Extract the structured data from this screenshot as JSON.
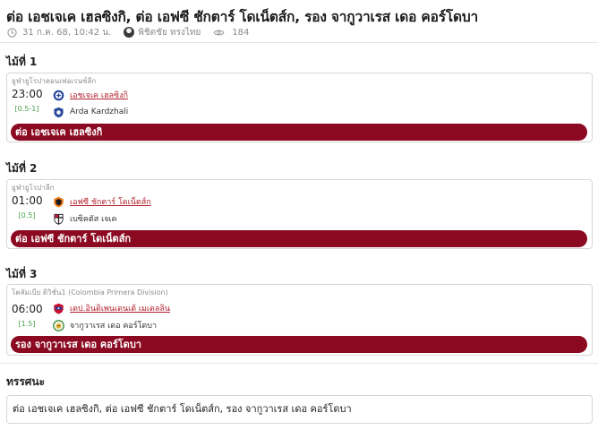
{
  "header": {
    "title": "ต่อ เอชเจเค เฮลซิงกิ, ต่อ เอฟซี ชักตาร์ โดเน็ตส์ก, รอง จากูวาเรส เดอ คอร์โดบา",
    "date": "31 ก.ค. 68, 10:42 น.",
    "author": "พิชิตชัย ทรงไทย",
    "views": "184"
  },
  "pairs": [
    {
      "heading": "ไม้ที่ 1",
      "league": "ยูฟ่ายูโรปาคอนเฟอเรนซ์ลีก",
      "time": "23:00",
      "handicap": "[0.5-1]",
      "home": {
        "name": "เอชเจเค เฮลซิงกิ",
        "logo": "hjk-helsinki-crest-icon"
      },
      "away": {
        "name": "Arda Kardzhali",
        "logo": "arda-kardzhali-crest-icon"
      },
      "pick": "ต่อ เอชเจเค เฮลซิงกิ"
    },
    {
      "heading": "ไม้ที่ 2",
      "league": "ยูฟ่ายูโรปาลีก",
      "time": "01:00",
      "handicap": "[0.5]",
      "home": {
        "name": "เอฟซี ชักตาร์ โดเน็ตส์ก",
        "logo": "shakhtar-donetsk-crest-icon"
      },
      "away": {
        "name": "เบซิคตัส เจเค",
        "logo": "besiktas-crest-icon"
      },
      "pick": "ต่อ เอฟซี ชักตาร์ โดเน็ตส์ก"
    },
    {
      "heading": "ไม้ที่ 3",
      "league": "โคลัมเบีย ดิวิชั่น1 (Colombia Primera Division)",
      "time": "06:00",
      "handicap": "[1.5]",
      "home": {
        "name": "เดป.อินดิเพนเดนเต้ เมเดลลิน",
        "logo": "independiente-medellin-crest-icon"
      },
      "away": {
        "name": "จากูวาเรส เดอ คอร์โดบา",
        "logo": "jaguares-cordoba-crest-icon"
      },
      "pick": "รอง จากูวาเรส เดอ คอร์โดบา"
    }
  ],
  "verdict": {
    "heading": "ทรรศนะ",
    "text": "ต่อ เอชเจเค เฮลซิงกิ, ต่อ เอฟซี ชักตาร์ โดเน็ตส์ก, รอง จากูวาเรส เดอ คอร์โดบา"
  },
  "colors": {
    "accent": "#8b0a22",
    "link": "#b3202c",
    "handicap": "#4aa14a",
    "muted": "#8a8a8a"
  }
}
